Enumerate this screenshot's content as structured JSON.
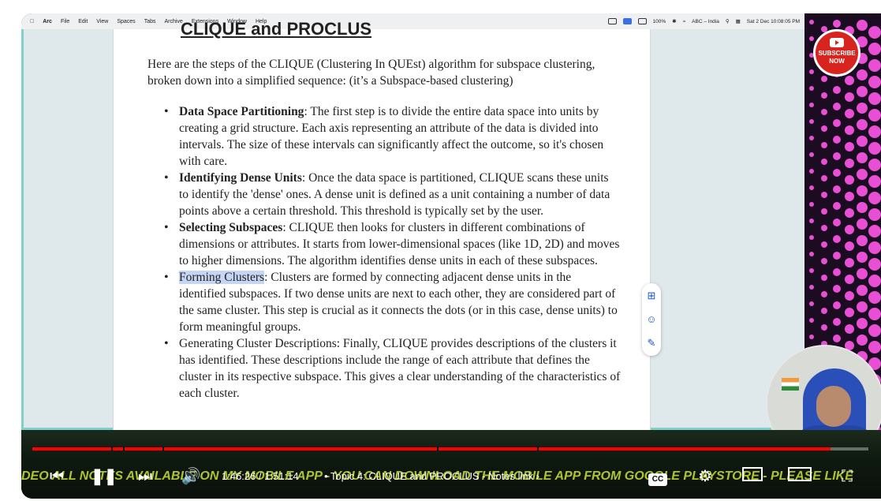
{
  "menubar": {
    "items": [
      "Arc",
      "File",
      "Edit",
      "View",
      "Spaces",
      "Tabs",
      "Archive",
      "Extensions",
      "Window",
      "Help"
    ],
    "status": {
      "battery": "100%",
      "input": "ABC – India",
      "datetime": "Sat 2 Dec  10:08:05 PM"
    }
  },
  "document": {
    "heading": "CLIQUE and PROCLUS",
    "intro": "Here are the steps of the CLIQUE (Clustering In QUEst) algorithm for subspace clustering, broken down into a simplified sequence: (it’s a Subspace-based clustering)",
    "steps": [
      {
        "title": "Data Space Partitioning",
        "sep": ":",
        "text": " The first step is to divide the entire data space into units by creating a grid structure. Each axis representing an attribute of the data is divided into intervals. The size of these intervals can significantly affect the outcome, so it's chosen with care."
      },
      {
        "title": "Identifying Dense Units",
        "sep": ":",
        "text": " Once the data space is partitioned, CLIQUE scans these units to identify the 'dense' ones. A dense unit is defined as a unit containing a number of data points above a certain threshold. This threshold is typically set by the user."
      },
      {
        "title": "Selecting Subspaces",
        "sep": ":",
        "text": " CLIQUE then looks for clusters in different combinations of dimensions or attributes. It starts from lower-dimensional spaces (like 1D, 2D) and moves to higher dimensions. The algorithm identifies dense units in each of these subspaces."
      },
      {
        "title": "Forming Clusters",
        "sep": ":",
        "text": " Clusters are formed by connecting adjacent dense units in the identified subspaces. If two dense units are next to each other, they are considered part of the same cluster. This step is crucial as it connects the dots (or in this case, dense units) to form meaningful groups."
      },
      {
        "title": "",
        "sep": "",
        "text": "Generating Cluster Descriptions: Finally, CLIQUE provides descriptions of the clusters it has identified. These descriptions include the range of each attribute that defines the cluster in its respective subspace. This gives a clear understanding of the characteristics of each cluster."
      }
    ]
  },
  "subscribe": {
    "line1": "SUBSCRIBE",
    "line2": "NOW"
  },
  "player": {
    "time_current": "1:46:26",
    "time_total": "1:51:14",
    "time_sep": " / ",
    "chapter": "• Topic 4: CLIQUE and PROCLUS - Notes link ›",
    "progress": 0.955,
    "ticker": "DEO ALL NOTES AVAILABLE ON MY MOBILE APP - YOU CAN DOWNLOAD THE MOBILE APP FROM GOOGLE PLAYSTORE - PLEASE LIKE",
    "cc_label": "CC"
  }
}
